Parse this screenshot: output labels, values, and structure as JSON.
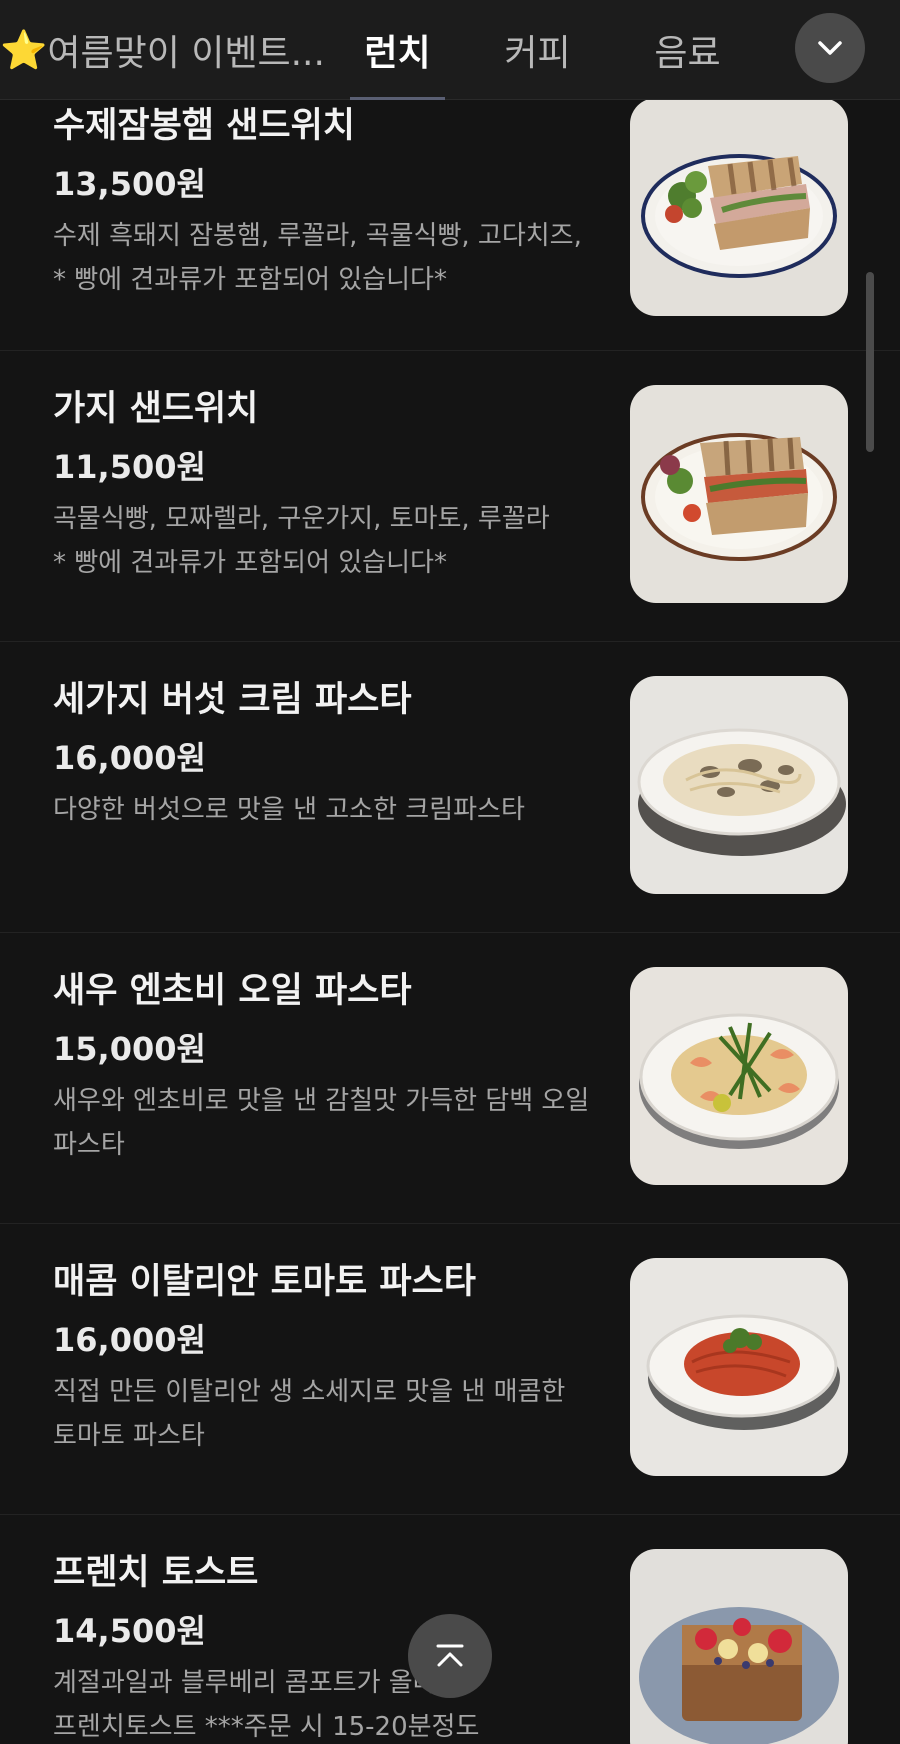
{
  "tabs": {
    "event_star": "⭐",
    "event": "여름맞이 이벤트...",
    "lunch": "런치",
    "coffee": "커피",
    "drink": "음료",
    "active": "lunch"
  },
  "icons": {
    "expand": "chevron-down-icon",
    "scroll_top": "chevron-up-icon"
  },
  "colors": {
    "background": "#141414",
    "tabbar": "#1c1c1c",
    "star": "#f6c234"
  },
  "menu": [
    {
      "name": "수제잠봉햄 샌드위치",
      "price": "13,500원",
      "desc": "수제 흑돼지 잠봉햄,  루꼴라, 곡물식빵, 고다치즈,\n* 빵에 견과류가 포함되어 있습니다*",
      "image": "sandwich-ham-image"
    },
    {
      "name": "가지 샌드위치",
      "price": "11,500원",
      "desc": "곡물식빵, 모짜렐라, 구운가지, 토마토, 루꼴라\n* 빵에 견과류가 포함되어 있습니다*",
      "image": "sandwich-eggplant-image"
    },
    {
      "name": "세가지 버섯 크림 파스타",
      "price": "16,000원",
      "desc": "다양한 버섯으로 맛을 낸 고소한 크림파스타",
      "image": "mushroom-pasta-image"
    },
    {
      "name": "새우 엔초비 오일 파스타",
      "price": "15,000원",
      "desc": "새우와 엔초비로 맛을 낸 감칠맛 가득한 담백 오일\n파스타",
      "image": "shrimp-pasta-image"
    },
    {
      "name": "매콤 이탈리안 토마토 파스타",
      "price": "16,000원",
      "desc": "직접 만든 이탈리안 생 소세지로 맛을 낸 매콤한\n토마토 파스타",
      "image": "tomato-pasta-image"
    },
    {
      "name": "프렌치 토스트",
      "price": "14,500원",
      "desc": "계절과일과 블루베리 콤포트가 올라간\n프렌치토스트  ***주문 시 15-20분정도",
      "image": "french-toast-image"
    }
  ]
}
